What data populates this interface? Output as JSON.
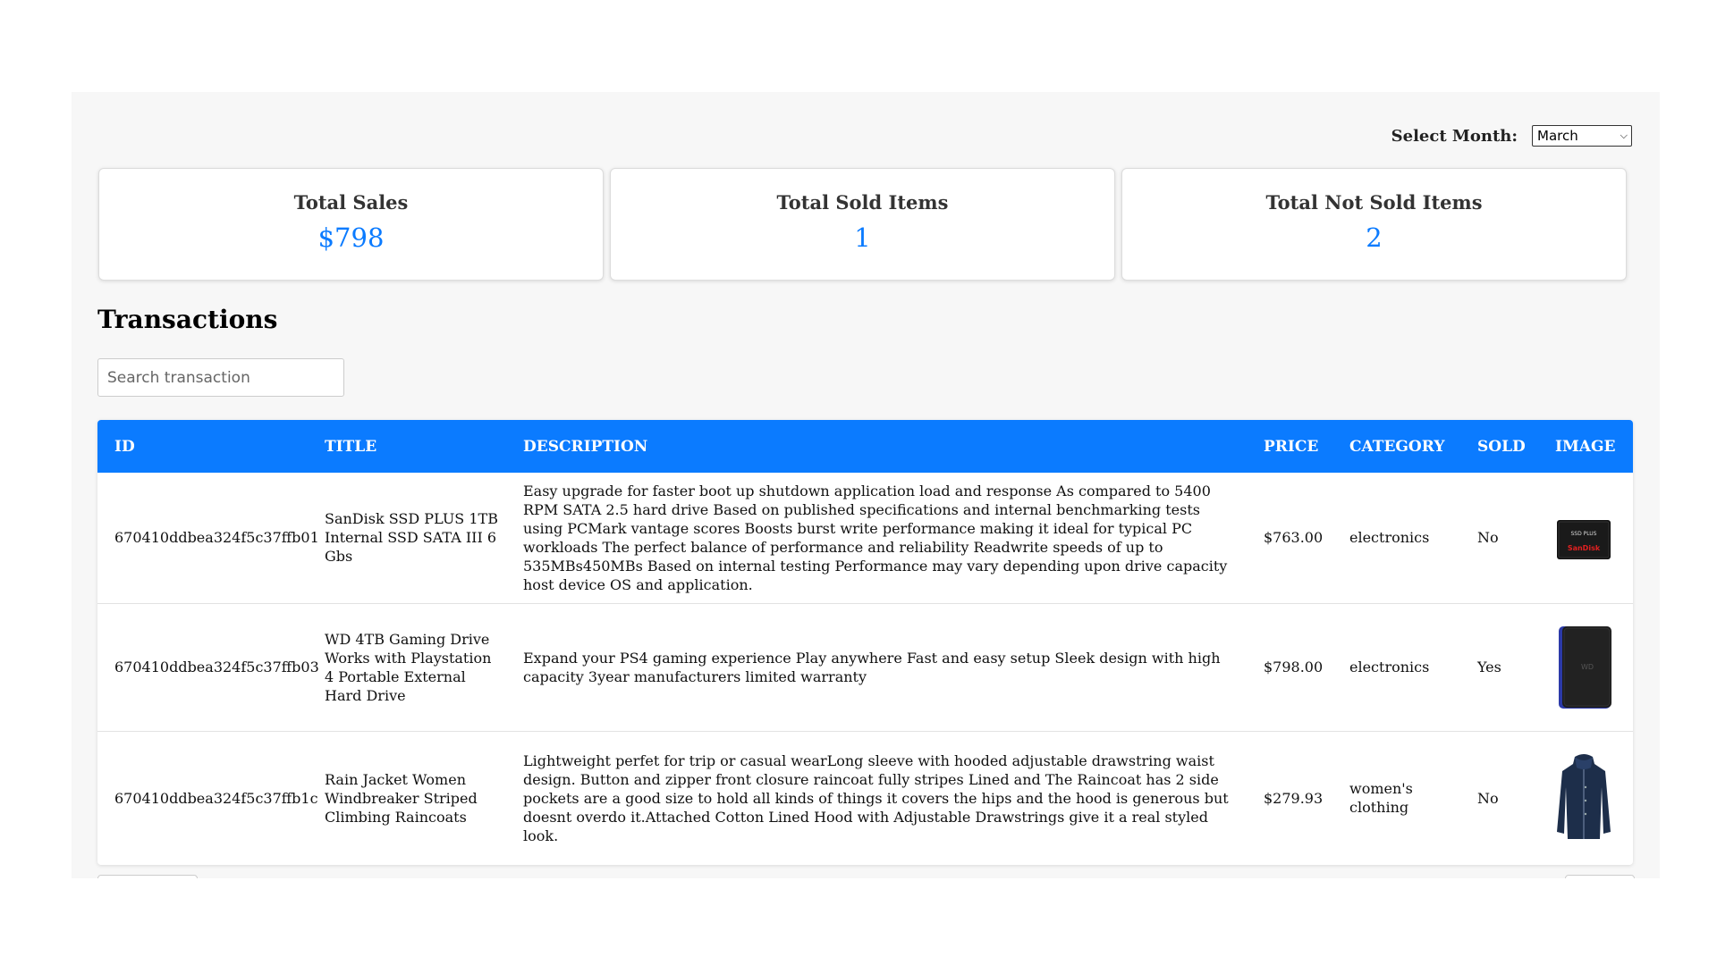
{
  "header": {
    "month_label": "Select Month:",
    "month_value": "March"
  },
  "stats": [
    {
      "title": "Total Sales",
      "value": "$798"
    },
    {
      "title": "Total Sold Items",
      "value": "1"
    },
    {
      "title": "Total Not Sold Items",
      "value": "2"
    }
  ],
  "transactions": {
    "heading": "Transactions",
    "search_placeholder": "Search transaction",
    "columns": [
      "ID",
      "TITLE",
      "DESCRIPTION",
      "PRICE",
      "CATEGORY",
      "SOLD",
      "IMAGE"
    ],
    "rows": [
      {
        "id": "670410ddbea324f5c37ffb01",
        "title": "SanDisk SSD PLUS 1TB Internal SSD SATA III 6 Gbs",
        "description": "Easy upgrade for faster boot up shutdown application load and response As compared to 5400 RPM SATA 2.5 hard drive Based on published specifications and internal benchmarking tests using PCMark vantage scores Boosts burst write performance making it ideal for typical PC workloads The perfect balance of performance and reliability Readwrite speeds of up to 535MBs450MBs Based on internal testing Performance may vary depending upon drive capacity host device OS and application.",
        "price": "$763.00",
        "category": "electronics",
        "sold": "No",
        "image": "ssd-icon",
        "image_brand": "SanDisk",
        "image_label": "SSD PLUS"
      },
      {
        "id": "670410ddbea324f5c37ffb03",
        "title": "WD 4TB Gaming Drive Works with Playstation 4 Portable External Hard Drive",
        "description": "Expand your PS4 gaming experience Play anywhere Fast and easy setup Sleek design with high capacity 3year manufacturers limited warranty",
        "price": "$798.00",
        "category": "electronics",
        "sold": "Yes",
        "image": "hard-drive-icon",
        "image_brand": "WD"
      },
      {
        "id": "670410ddbea324f5c37ffb1c",
        "title": "Rain Jacket Women Windbreaker Striped Climbing Raincoats",
        "description": "Lightweight perfet for trip or casual wearLong sleeve with hooded adjustable drawstring waist design. Button and zipper front closure raincoat fully stripes Lined and The Raincoat has 2 side pockets are a good size to hold all kinds of things it covers the hips and the hood is generous but doesnt overdo it.Attached Cotton Lined Hood with Adjustable Drawstrings give it a real styled look.",
        "price": "$279.93",
        "category": "women's clothing",
        "sold": "No",
        "image": "jacket-icon"
      }
    ]
  },
  "colors": {
    "accent": "#0b7bff",
    "panel_bg": "#f7f7f7"
  }
}
